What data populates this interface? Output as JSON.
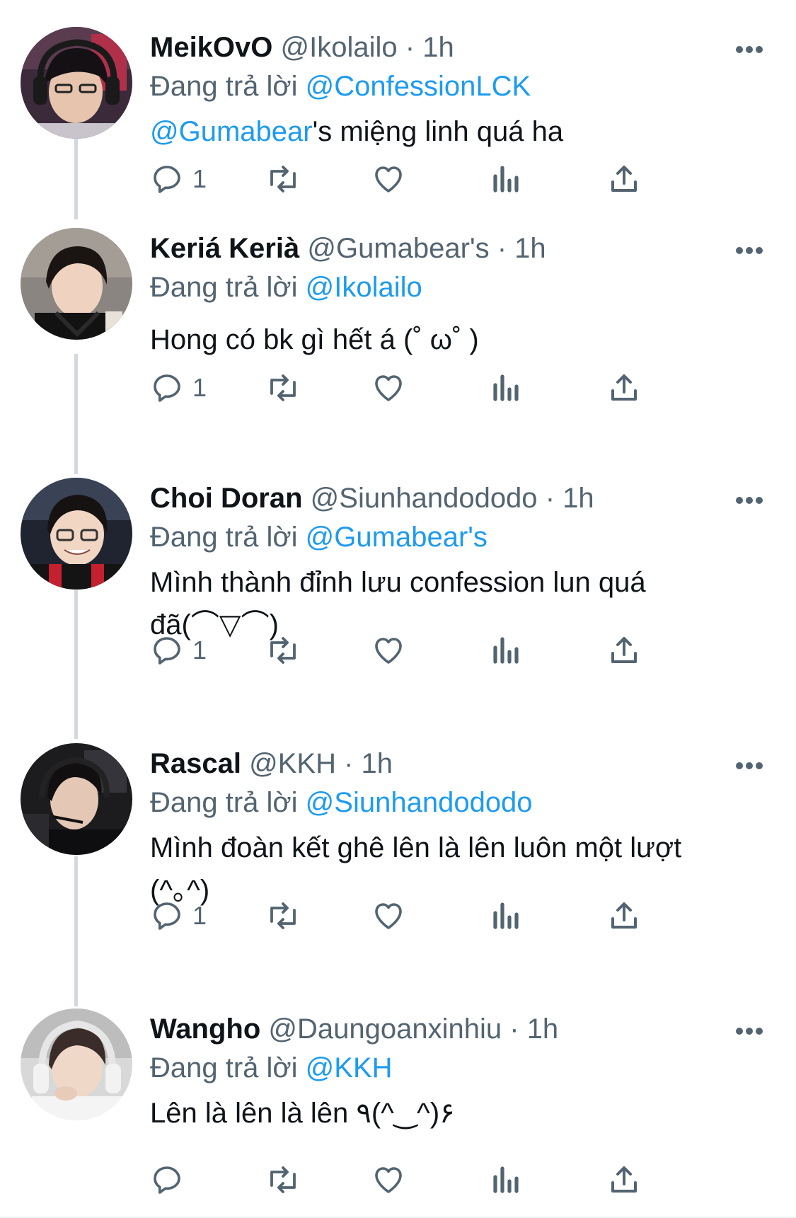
{
  "accent_color": "#1d9bf0",
  "secondary_text_color": "#536471",
  "reply_prefix": "Đang trả lời",
  "tweets": [
    {
      "display_name": "MeikOvO",
      "handle": "@Ikolailo",
      "dot": "·",
      "time": "1h",
      "reply_to": "@ConfessionLCK",
      "text_mention": "@Gumabear",
      "text": "'s miệng linh quá ha",
      "reply_count": "1",
      "avatar": "avatar-meikovo"
    },
    {
      "display_name": "Keriá Kerià",
      "handle": "@Gumabear's",
      "dot": "·",
      "time": "1h",
      "reply_to": "@Ikolailo",
      "text_mention": "",
      "text": "Hong có bk gì hết á (˚ ω˚ )",
      "reply_count": "1",
      "avatar": "avatar-keria"
    },
    {
      "display_name": "Choi Doran",
      "handle": "@Siunhandododo",
      "dot": "·",
      "time": "1h",
      "reply_to": "@Gumabear's",
      "text_mention": "",
      "text": "Mình thành đỉnh lưu confession lun quá\nđã(⌒▽⌒)",
      "reply_count": "1",
      "avatar": "avatar-doran"
    },
    {
      "display_name": "Rascal",
      "handle": "@KKH",
      "dot": "·",
      "time": "1h",
      "reply_to": "@Siunhandododo",
      "text_mention": "",
      "text": "Mình đoàn kết ghê lên là lên luôn một lượt\n(^｡^)",
      "reply_count": "1",
      "avatar": "avatar-rascal"
    },
    {
      "display_name": "Wangho",
      "handle": "@Daungoanxinhiu",
      "dot": "·",
      "time": "1h",
      "reply_to": "@KKH",
      "text_mention": "",
      "text": "Lên là lên là lên ٩(^‿^)۶",
      "reply_count": "",
      "avatar": "avatar-wangho"
    }
  ]
}
